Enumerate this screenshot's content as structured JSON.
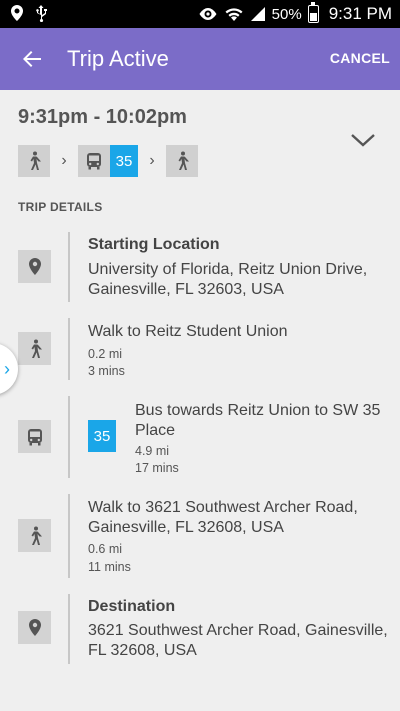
{
  "status_bar": {
    "battery": "50%",
    "time": "9:31 PM"
  },
  "app_bar": {
    "title": "Trip Active",
    "cancel_label": "CANCEL"
  },
  "trip": {
    "time_range": "9:31pm - 10:02pm",
    "route_number": "35"
  },
  "details": {
    "heading": "TRIP DETAILS",
    "steps": [
      {
        "title": "Starting Location",
        "body": "University of Florida, Reitz Union Drive, Gainesville, FL 32603, USA"
      },
      {
        "title": "Walk to Reitz Student Union",
        "distance": "0.2 mi",
        "duration": "3 mins"
      },
      {
        "route": "35",
        "title": "Bus towards Reitz Union to SW 35 Place",
        "distance": "4.9 mi",
        "duration": "17 mins"
      },
      {
        "title": "Walk to 3621 Southwest Archer Road, Gainesville, FL 32608, USA",
        "distance": "0.6 mi",
        "duration": "11 mins"
      },
      {
        "title": "Destination",
        "body": "3621 Southwest Archer Road, Gainesville, FL 32608, USA"
      }
    ]
  },
  "colors": {
    "app_bar": "#7b6cc8",
    "route_badge": "#1aa6e8",
    "background": "#efefef"
  },
  "icons": [
    "location-pin-icon",
    "usb-icon",
    "eye-icon",
    "wifi-icon",
    "signal-icon",
    "battery-icon",
    "back-arrow-icon",
    "walk-icon",
    "bus-icon",
    "chevron-down-icon",
    "chevron-right-icon"
  ]
}
